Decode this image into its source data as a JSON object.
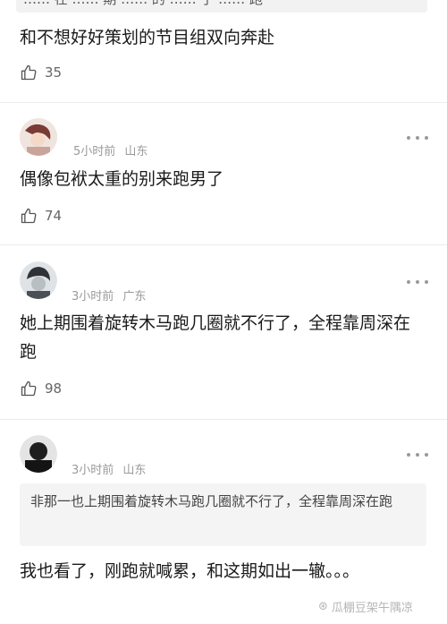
{
  "top_quote": "…… 在 …… 期 …… 的 …… 了 …… 跑",
  "comments": [
    {
      "text": "和不想好好策划的节目组双向奔赴",
      "likes": "35"
    },
    {
      "time": "5小时前",
      "location": "山东",
      "text": "偶像包袱太重的别来跑男了",
      "likes": "74"
    },
    {
      "time": "3小时前",
      "location": "广东",
      "text": "她上期围着旋转木马跑几圈就不行了，全程靠周深在跑",
      "likes": "98"
    },
    {
      "time": "3小时前",
      "location": "山东",
      "quote": "非那一也上期围着旋转木马跑几圈就不行了，全程靠周深在跑",
      "text": "我也看了，刚跑就喊累，和这期如出一辙。。。"
    }
  ],
  "watermark": "瓜棚豆架午隅凉",
  "icons": {
    "like": "thumbs-up-icon",
    "more": "more-dots-icon",
    "watermark": "logo-icon"
  }
}
